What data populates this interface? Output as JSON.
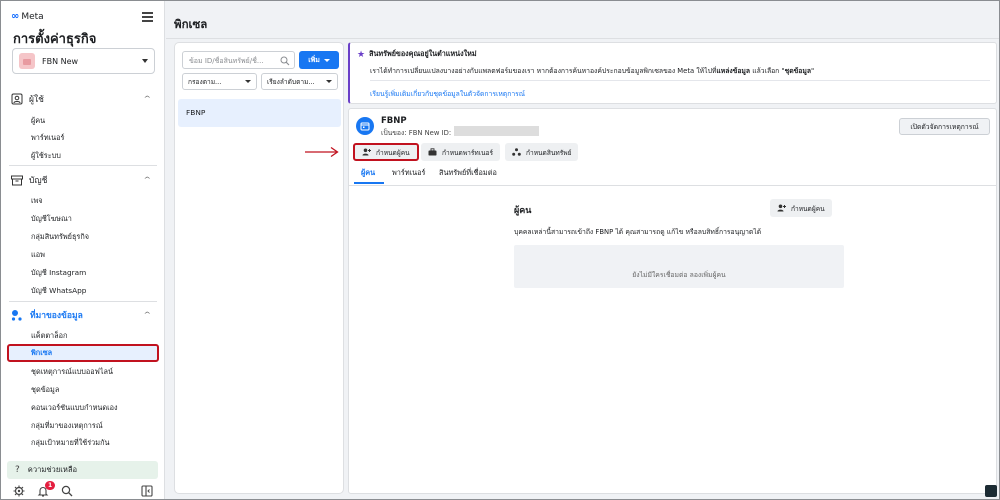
{
  "sidebar": {
    "brand": "Meta",
    "title": "การตั้งค่าธุรกิจ",
    "account": "FBN New",
    "sections": [
      {
        "label": "ผู้ใช้",
        "items": [
          "ผู้คน",
          "พาร์ทเนอร์",
          "ผู้ใช้ระบบ"
        ]
      },
      {
        "label": "บัญชี",
        "items": [
          "เพจ",
          "บัญชีโฆษณา",
          "กลุ่มสินทรัพย์ธุรกิจ",
          "แอพ",
          "บัญชี Instagram",
          "บัญชี WhatsApp"
        ]
      },
      {
        "label": "ที่มาของข้อมูล",
        "items": [
          "แค็ตตาล็อก",
          "พิกเซล",
          "ชุดเหตุการณ์แบบออฟไลน์",
          "ชุดข้อมูล",
          "คอนเวอร์ชันแบบกำหนดเอง",
          "กลุ่มที่มาของเหตุการณ์",
          "กลุ่มเป้าหมายที่ใช้ร่วมกัน"
        ]
      }
    ],
    "help": "ความช่วยเหลือ",
    "notifications_count": "1"
  },
  "header": {
    "title": "พิกเซล"
  },
  "list_panel": {
    "search_placeholder": "ข้อม ID/ชื่อสินทรัพย์/ชื่...",
    "add_label": "เพิ่ม",
    "filter_label": "กรองตาม...",
    "sort_label": "เรียงลำดับตาม...",
    "items": [
      "FBNP"
    ]
  },
  "notice": {
    "title": "สินทรัพย์ของคุณอยู่ในตำแหน่งใหม่",
    "body_prefix": "เราได้ทำการเปลี่ยนแปลงบางอย่างกับแพลตฟอร์มของเรา หากต้องการค้นหาองค์ประกอบข้อมูลพิกเซลของ Meta ให้ไปที่",
    "body_bold1": "แหล่งข้อมูล",
    "body_mid": " แล้วเลือก \"",
    "body_bold2": "ชุดข้อมูล",
    "body_suffix": "\"",
    "link": "เรียนรู้เพิ่มเติมเกี่ยวกับชุดข้อมูลในตัวจัดการเหตุการณ์"
  },
  "detail": {
    "name": "FBNP",
    "owner": "เป็นของ: FBN New  ID:",
    "open_events_manager": "เปิดตัวจัดการเหตุการณ์",
    "actions": [
      "กำหนดผู้คน",
      "กำหนดพาร์ทเนอร์",
      "กำหนดสินทรัพย์"
    ],
    "tabs": [
      "ผู้คน",
      "พาร์ทเนอร์",
      "สินทรัพย์ที่เชื่อมต่อ"
    ],
    "people": {
      "title": "ผู้คน",
      "add_label": "กำหนดผู้คน",
      "description": "บุคคลเหล่านี้สามารถเข้าถึง FBNP ได้ คุณสามารถดู แก้ไข หรือลบสิทธิ์การอนุญาตได้",
      "empty": "ยังไม่มีใครเชื่อมต่อ ลองเพิ่มผู้คน"
    }
  },
  "colors": {
    "accent": "#1877f2",
    "highlight": "#c1121f",
    "notice_border": "#6a3fc8"
  }
}
